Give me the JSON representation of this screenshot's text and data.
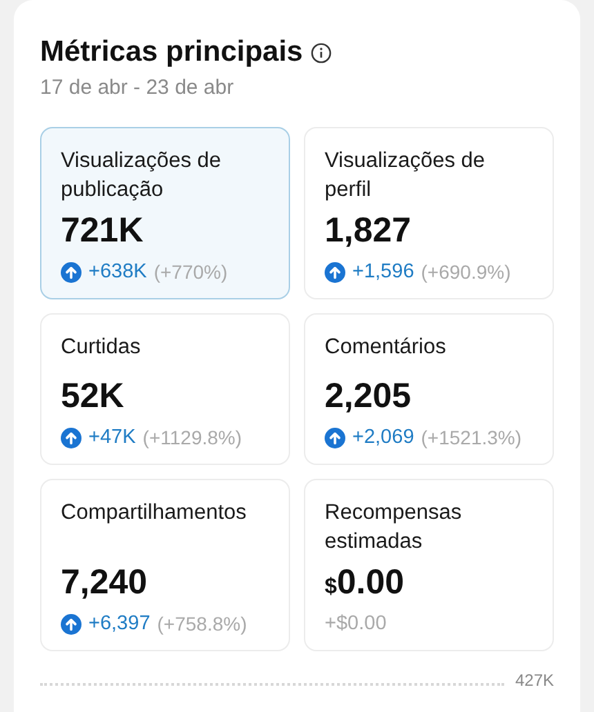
{
  "title": "Métricas principais",
  "date_range": "17 de abr - 23 de abr",
  "metrics": [
    {
      "label": "Visualizações de publicação",
      "value": "721K",
      "kind": "up",
      "delta": "+638K",
      "percent": "(+770%)",
      "selected": true
    },
    {
      "label": "Visualizações de perfil",
      "value": "1,827",
      "kind": "up",
      "delta": "+1,596",
      "percent": "(+690.9%)",
      "selected": false
    },
    {
      "label": "Curtidas",
      "value": "52K",
      "kind": "up",
      "delta": "+47K",
      "percent": "(+1129.8%)",
      "selected": false
    },
    {
      "label": "Comentários",
      "value": "2,205",
      "kind": "up",
      "delta": "+2,069",
      "percent": "(+1521.3%)",
      "selected": false
    },
    {
      "label": "Compartilhamentos",
      "value": "7,240",
      "kind": "up",
      "delta": "+6,397",
      "percent": "(+758.8%)",
      "selected": false
    },
    {
      "label": "Recompensas estimadas",
      "currency": "$",
      "value": "0.00",
      "kind": "flat",
      "delta": "+$0.00",
      "selected": false
    }
  ],
  "chart_axis_label": "427K"
}
